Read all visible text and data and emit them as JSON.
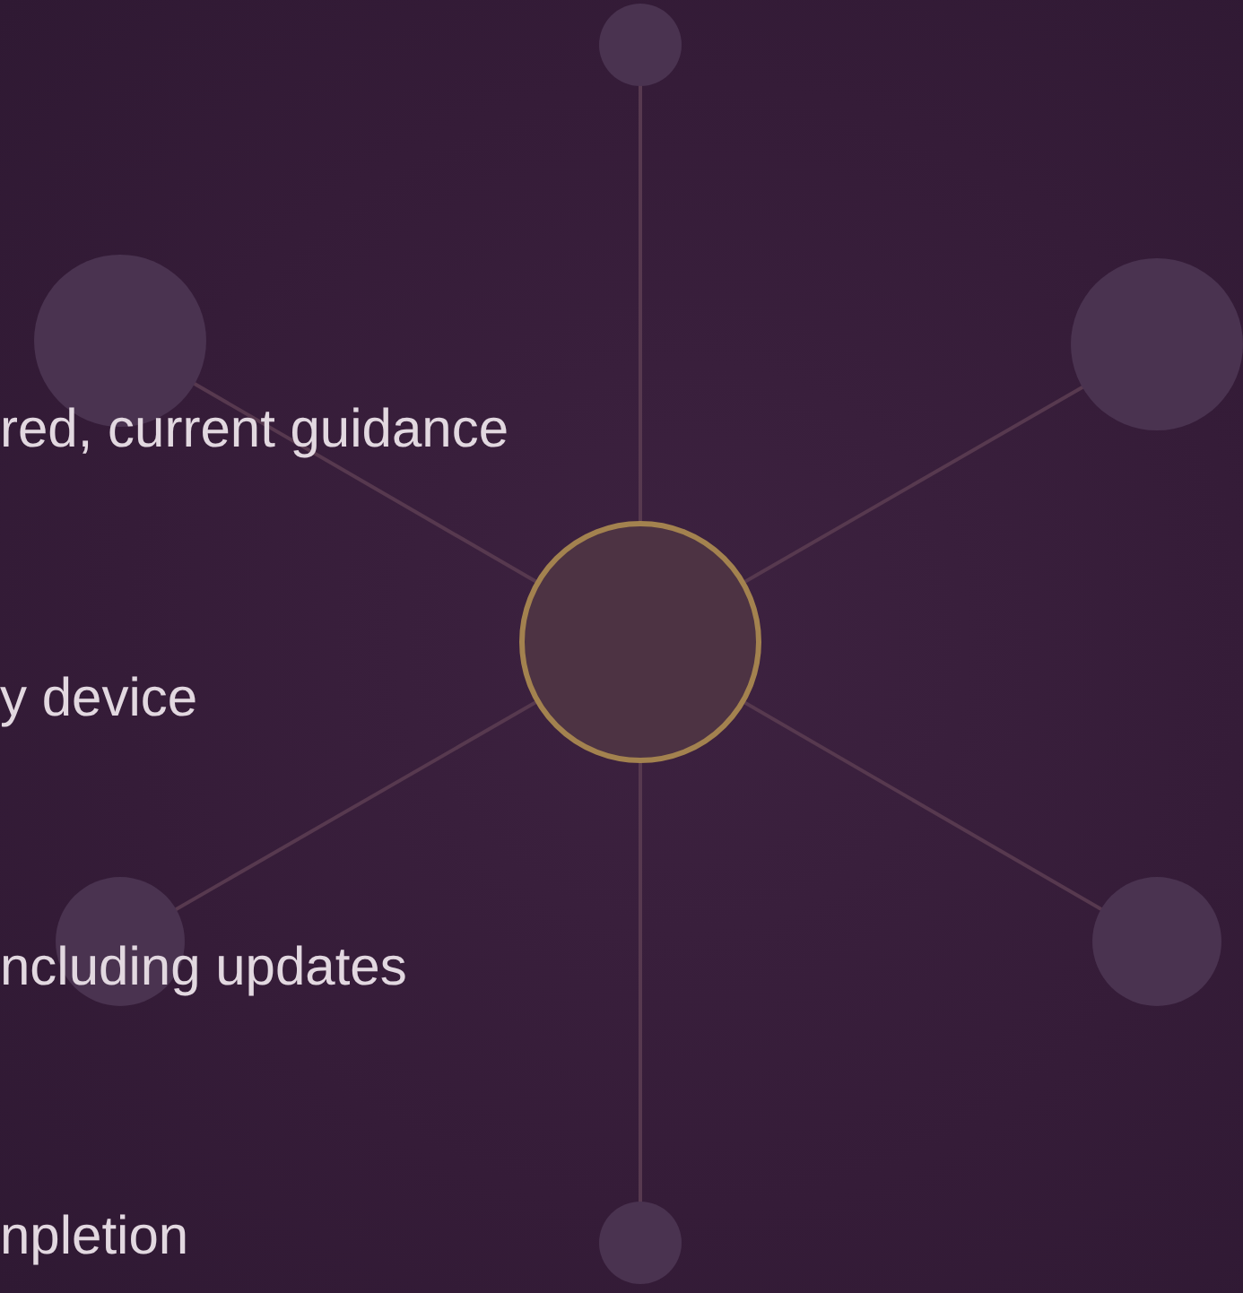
{
  "feature_lines": [
    "red, current guidance",
    "y device",
    "ncluding updates",
    "npletion"
  ]
}
